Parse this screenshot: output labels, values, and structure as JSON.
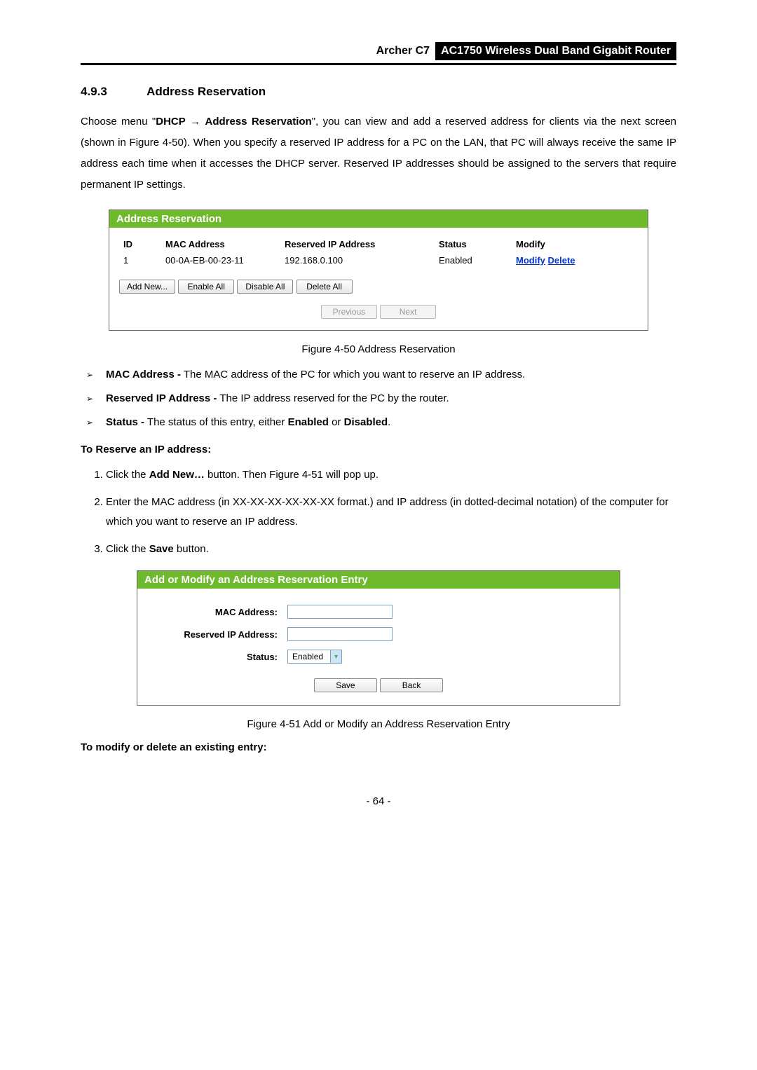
{
  "header": {
    "model": "Archer C7",
    "title": "AC1750 Wireless Dual Band Gigabit Router"
  },
  "section": {
    "number": "4.9.3",
    "title": "Address Reservation"
  },
  "intro": {
    "prefix": "Choose menu \"",
    "menu1": "DHCP",
    "arrow": "→",
    "menu2": "Address Reservation",
    "suffix": "\", you can view and add a reserved address for clients via the next screen (shown in Figure 4-50). When you specify a reserved IP address for a PC on the LAN, that PC will always receive the same IP address each time when it accesses the DHCP server. Reserved IP addresses should be assigned to the servers that require permanent IP settings."
  },
  "fig1": {
    "panel_title": "Address Reservation",
    "headers": {
      "id": "ID",
      "mac": "MAC Address",
      "ip": "Reserved IP Address",
      "status": "Status",
      "modify": "Modify"
    },
    "row": {
      "id": "1",
      "mac": "00-0A-EB-00-23-11",
      "ip": "192.168.0.100",
      "status": "Enabled",
      "modify": "Modify",
      "delete": "Delete"
    },
    "buttons": {
      "add": "Add New...",
      "enable": "Enable All",
      "disable": "Disable All",
      "delete": "Delete All",
      "prev": "Previous",
      "next": "Next"
    },
    "caption": "Figure 4-50 Address Reservation"
  },
  "bullets": {
    "b1_term": "MAC Address -",
    "b1_text": " The MAC address of the PC for which you want to reserve an IP address.",
    "b2_term": "Reserved IP Address -",
    "b2_text": " The IP address reserved for the PC by the router.",
    "b3_term": "Status -",
    "b3_text_a": " The status of this entry, either ",
    "b3_en": "Enabled",
    "b3_or": " or ",
    "b3_dis": "Disabled",
    "b3_dot": "."
  },
  "reserve_heading": "To Reserve an IP address:",
  "steps": {
    "s1a": "Click the ",
    "s1b": "Add New…",
    "s1c": " button. Then Figure 4-51 will pop up.",
    "s2": "Enter the MAC address (in XX-XX-XX-XX-XX-XX format.) and IP address (in dotted-decimal notation) of the computer for which you want to reserve an IP address.",
    "s3a": "Click the ",
    "s3b": "Save",
    "s3c": " button."
  },
  "fig2": {
    "panel_title": "Add or Modify an Address Reservation Entry",
    "labels": {
      "mac": "MAC Address:",
      "ip": "Reserved IP Address:",
      "status": "Status:"
    },
    "status_value": "Enabled",
    "buttons": {
      "save": "Save",
      "back": "Back"
    },
    "caption": "Figure 4-51 Add or Modify an Address Reservation Entry"
  },
  "modify_heading": "To modify or delete an existing entry:",
  "page_number": "- 64 -"
}
